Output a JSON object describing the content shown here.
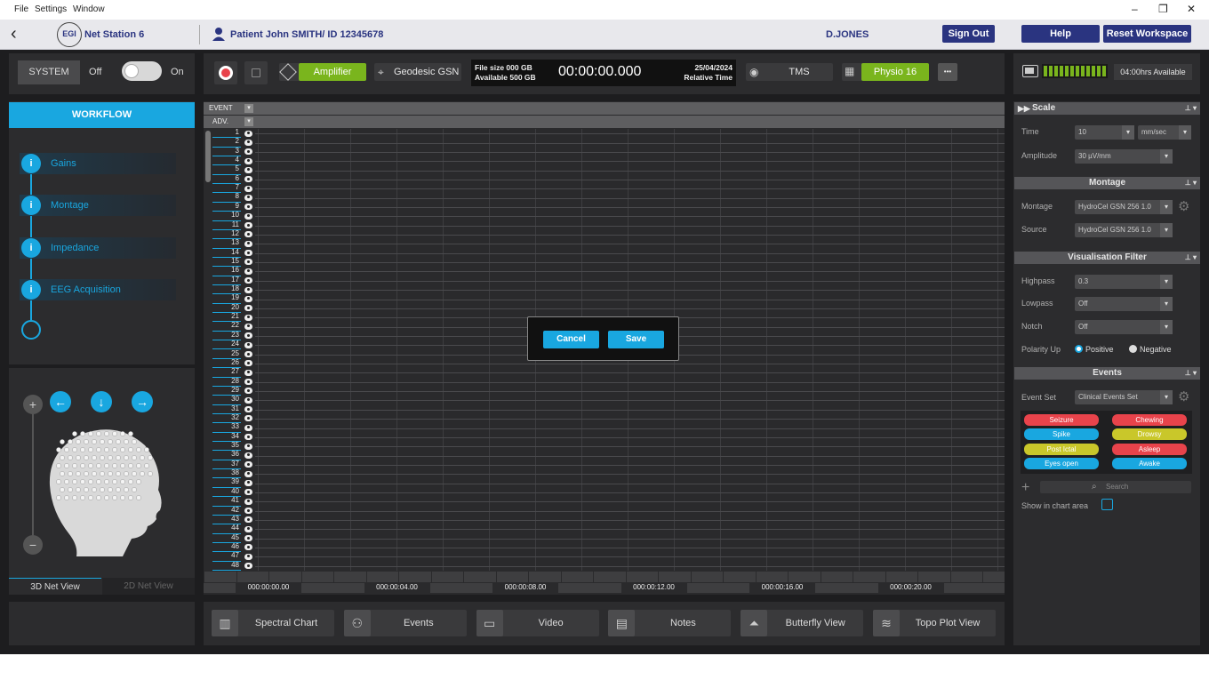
{
  "menu": {
    "file": "File",
    "settings": "Settings",
    "window": "Window"
  },
  "window_controls": {
    "minimize": "–",
    "restore": "❐",
    "close": "✕"
  },
  "header": {
    "app_badge": "EGI",
    "app_name": "Net Station 6",
    "patient": "Patient John SMITH/ ID 12345678",
    "user": "D.JONES",
    "sign_out": "Sign Out",
    "help": "Help",
    "reset_workspace": "Reset Workspace"
  },
  "system": {
    "label": "SYSTEM",
    "off": "Off",
    "on": "On"
  },
  "toolbar": {
    "amplifier": "Amplifier",
    "geodesic": "Geodesic GSN",
    "file_size": "File size 000 GB",
    "available": "Available 500 GB",
    "timer": "00:00:00.000",
    "date": "25/04/2024",
    "relative_time": "Relative Time",
    "tms": "TMS",
    "physio": "Physio 16",
    "more": "•••",
    "battery": "04:00hrs Available"
  },
  "workflow": {
    "title": "WORKFLOW",
    "items": [
      {
        "icon": "i",
        "label": "Gains"
      },
      {
        "icon": "i",
        "label": "Montage"
      },
      {
        "icon": "i",
        "label": "Impedance"
      },
      {
        "icon": "i",
        "label": "EEG Acquisition"
      }
    ]
  },
  "netview": {
    "tab_3d": "3D Net View",
    "tab_2d": "2D Net View"
  },
  "chart": {
    "event_label": "EVENT",
    "adv_label": "ADV.",
    "channels": [
      "1",
      "2",
      "3",
      "4",
      "5",
      "6",
      "7",
      "8",
      "9",
      "10",
      "11",
      "12",
      "13",
      "14",
      "15",
      "16",
      "17",
      "18",
      "19",
      "20",
      "21",
      "22",
      "23",
      "24",
      "25",
      "26",
      "27",
      "28",
      "29",
      "30",
      "31",
      "32",
      "33",
      "34",
      "35",
      "36",
      "37",
      "38",
      "39",
      "40",
      "41",
      "42",
      "43",
      "44",
      "45",
      "46",
      "47",
      "48"
    ],
    "time_ticks": [
      "000:00:00.00",
      "000:00:04.00",
      "000:00:08.00",
      "000:00:12.00",
      "000:00:16.00",
      "000:00:20.00"
    ]
  },
  "dialog": {
    "cancel": "Cancel",
    "save": "Save"
  },
  "right": {
    "scale": {
      "title": "Scale",
      "time_label": "Time",
      "time_value": "10",
      "time_unit": "mm/sec",
      "amp_label": "Amplitude",
      "amp_value": "30 µV/mm"
    },
    "montage": {
      "title": "Montage",
      "montage_label": "Montage",
      "montage_value": "HydroCel GSN 256 1.0",
      "source_label": "Source",
      "source_value": "HydroCel GSN 256 1.0"
    },
    "filter": {
      "title": "Visualisation Filter",
      "highpass_label": "Highpass",
      "highpass_value": "0.3",
      "lowpass_label": "Lowpass",
      "lowpass_value": "Off",
      "notch_label": "Notch",
      "notch_value": "Off",
      "polarity_label": "Polarity Up",
      "positive": "Positive",
      "negative": "Negative"
    },
    "events": {
      "title": "Events",
      "set_label": "Event Set",
      "set_value": "Clinical Events Set",
      "buttons": [
        {
          "label": "Seizure",
          "color": "#e8434b"
        },
        {
          "label": "Chewing",
          "color": "#e8434b"
        },
        {
          "label": "Spike",
          "color": "#19a7e0"
        },
        {
          "label": "Drowsy",
          "color": "#c9c72a"
        },
        {
          "label": "Post Ictal",
          "color": "#c9c72a"
        },
        {
          "label": "Asleep",
          "color": "#e8434b"
        },
        {
          "label": "Eyes open",
          "color": "#19a7e0"
        },
        {
          "label": "Awake",
          "color": "#19a7e0"
        }
      ],
      "search_placeholder": "Search",
      "show_in_chart": "Show in chart area"
    }
  },
  "bottom_tabs": [
    {
      "icon": "spectral-chart-icon",
      "label": "Spectral Chart"
    },
    {
      "icon": "events-icon",
      "label": "Events"
    },
    {
      "icon": "video-icon",
      "label": "Video"
    },
    {
      "icon": "notes-icon",
      "label": "Notes"
    },
    {
      "icon": "butterfly-view-icon",
      "label": "Butterfly View"
    },
    {
      "icon": "topo-plot-view-icon",
      "label": "Topo Plot View"
    }
  ]
}
